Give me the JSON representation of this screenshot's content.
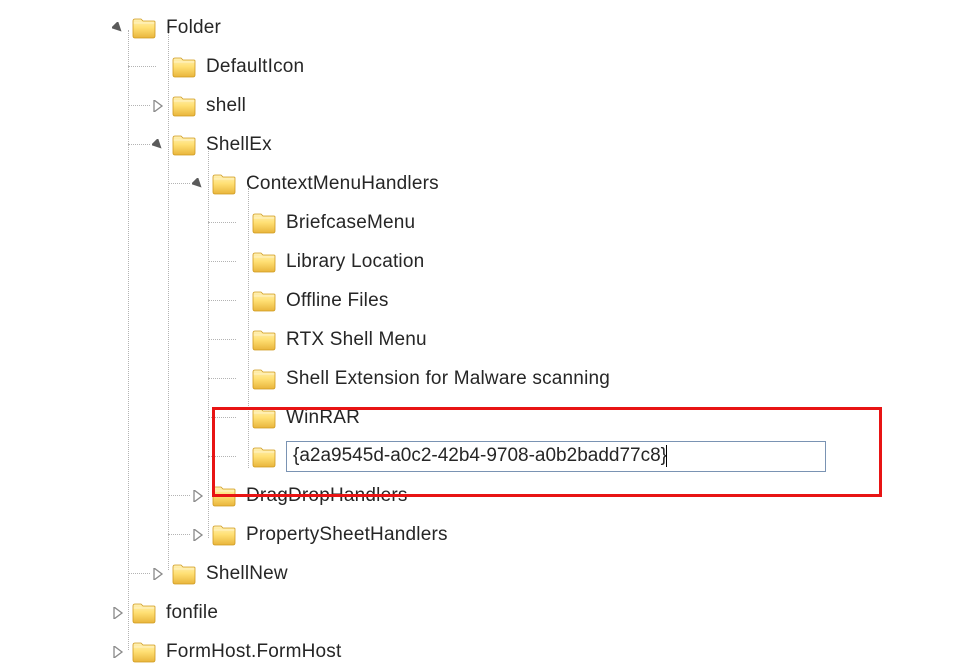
{
  "tree": {
    "folder": {
      "label": "Folder",
      "defaultIcon": {
        "label": "DefaultIcon"
      },
      "shell": {
        "label": "shell"
      },
      "shellEx": {
        "label": "ShellEx",
        "contextMenuHandlers": {
          "label": "ContextMenuHandlers",
          "items": [
            {
              "label": "BriefcaseMenu"
            },
            {
              "label": "Library Location"
            },
            {
              "label": "Offline Files"
            },
            {
              "label": "RTX Shell Menu"
            },
            {
              "label": "Shell Extension for Malware scanning"
            },
            {
              "label": "WinRAR"
            }
          ],
          "editingValue": "{a2a9545d-a0c2-42b4-9708-a0b2badd77c8}"
        },
        "dragDropHandlers": {
          "label": "DragDropHandlers"
        },
        "propertySheetHandlers": {
          "label": "PropertySheetHandlers"
        }
      },
      "shellNew": {
        "label": "ShellNew"
      }
    },
    "fonfile": {
      "label": "fonfile"
    },
    "formHost": {
      "label": "FormHost.FormHost"
    }
  },
  "icons": {
    "expandedGlyph": "expanded-triangle",
    "collapsedGlyph": "collapsed-triangle",
    "folderGlyph": "folder"
  },
  "highlight": {
    "color": "#e81414"
  }
}
